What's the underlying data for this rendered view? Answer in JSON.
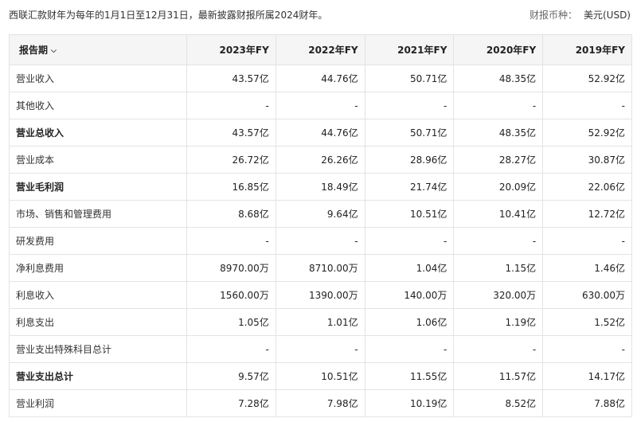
{
  "header": {
    "note": "西联汇款财年为每年的1月1日至12月31日，最新披露财报所属2024财年。",
    "currency_label": "财报币种：",
    "currency_value": "美元(USD)"
  },
  "table": {
    "period_label": "报告期",
    "columns": [
      "2023年FY",
      "2022年FY",
      "2021年FY",
      "2020年FY",
      "2019年FY"
    ],
    "rows": [
      {
        "label": "营业收入",
        "bold": false,
        "values": [
          "43.57亿",
          "44.76亿",
          "50.71亿",
          "48.35亿",
          "52.92亿"
        ]
      },
      {
        "label": "其他收入",
        "bold": false,
        "values": [
          "-",
          "-",
          "-",
          "-",
          "-"
        ]
      },
      {
        "label": "营业总收入",
        "bold": true,
        "values": [
          "43.57亿",
          "44.76亿",
          "50.71亿",
          "48.35亿",
          "52.92亿"
        ]
      },
      {
        "label": "营业成本",
        "bold": false,
        "values": [
          "26.72亿",
          "26.26亿",
          "28.96亿",
          "28.27亿",
          "30.87亿"
        ]
      },
      {
        "label": "营业毛利润",
        "bold": true,
        "values": [
          "16.85亿",
          "18.49亿",
          "21.74亿",
          "20.09亿",
          "22.06亿"
        ]
      },
      {
        "label": "市场、销售和管理费用",
        "bold": false,
        "values": [
          "8.68亿",
          "9.64亿",
          "10.51亿",
          "10.41亿",
          "12.72亿"
        ]
      },
      {
        "label": "研发费用",
        "bold": false,
        "values": [
          "-",
          "-",
          "-",
          "-",
          "-"
        ]
      },
      {
        "label": "净利息费用",
        "bold": false,
        "values": [
          "8970.00万",
          "8710.00万",
          "1.04亿",
          "1.15亿",
          "1.46亿"
        ]
      },
      {
        "label": "利息收入",
        "bold": false,
        "values": [
          "1560.00万",
          "1390.00万",
          "140.00万",
          "320.00万",
          "630.00万"
        ]
      },
      {
        "label": "利息支出",
        "bold": false,
        "values": [
          "1.05亿",
          "1.01亿",
          "1.06亿",
          "1.19亿",
          "1.52亿"
        ]
      },
      {
        "label": "营业支出特殊科目总计",
        "bold": false,
        "values": [
          "-",
          "-",
          "-",
          "-",
          "-"
        ]
      },
      {
        "label": "营业支出总计",
        "bold": true,
        "values": [
          "9.57亿",
          "10.51亿",
          "11.55亿",
          "11.57亿",
          "14.17亿"
        ]
      },
      {
        "label": "营业利润",
        "bold": false,
        "values": [
          "7.28亿",
          "7.98亿",
          "10.19亿",
          "8.52亿",
          "7.88亿"
        ]
      }
    ]
  }
}
